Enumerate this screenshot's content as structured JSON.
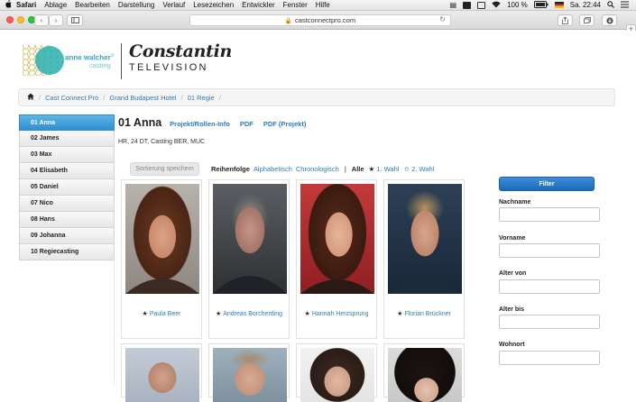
{
  "menubar": {
    "items": [
      "Safari",
      "Ablage",
      "Bearbeiten",
      "Darstellung",
      "Verlauf",
      "Lesezeichen",
      "Entwickler",
      "Fenster",
      "Hilfe"
    ],
    "battery": "100 %",
    "clock": "Sa. 22:44"
  },
  "browser": {
    "url": "castconnectpro.com"
  },
  "logos": {
    "casting_name": "anne walcher",
    "casting_mark": "®",
    "casting_word": "casting",
    "tv_line1": "Constantin",
    "tv_line2": "TELEVISION"
  },
  "breadcrumb": {
    "items": [
      "Cast Connect Pro",
      "Grand Budapest Hotel",
      "01 Regie"
    ]
  },
  "sidebar": {
    "items": [
      {
        "label": "01 Anna",
        "active": true
      },
      {
        "label": "02 James"
      },
      {
        "label": "03 Max"
      },
      {
        "label": "04 Elisabeth"
      },
      {
        "label": "05 Daniel"
      },
      {
        "label": "07 Nico"
      },
      {
        "label": "08 Hans"
      },
      {
        "label": "09 Johanna"
      },
      {
        "label": "10 Regiecasting"
      }
    ]
  },
  "role": {
    "title": "01 Anna",
    "links": [
      "Projekt/Rollen-Info",
      "PDF",
      "PDF (Projekt)"
    ],
    "description": "HR, 24 DT, Casting BER, MUC"
  },
  "sorting": {
    "save_button": "Sortierung speichern",
    "order_label": "Reihenfolge",
    "alpha": "Alphabetisch",
    "chrono": "Chronologisch",
    "all": "Alle",
    "first_choice": "1. Wahl",
    "second_choice": "2. Wahl"
  },
  "actors": [
    {
      "name": "Paula Beer"
    },
    {
      "name": "Andreas Borcherding"
    },
    {
      "name": "Hannah Herzsprung"
    },
    {
      "name": "Florian Brückner"
    }
  ],
  "filter": {
    "button": "Filter",
    "fields": [
      {
        "label": "Nachname",
        "value": ""
      },
      {
        "label": "Vorname",
        "value": ""
      },
      {
        "label": "Alter von",
        "value": ""
      },
      {
        "label": "Alter bis",
        "value": ""
      },
      {
        "label": "Wohnort",
        "value": ""
      }
    ]
  },
  "colors": {
    "accent": "#2d7cb8",
    "active_tab": "#2e8ed0",
    "filter_button": "#1d6ab7"
  }
}
